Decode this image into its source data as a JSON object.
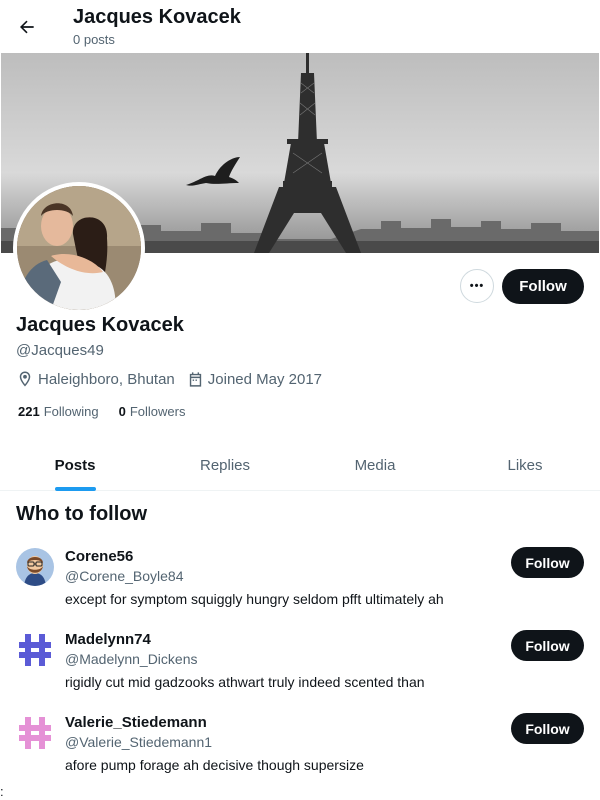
{
  "header": {
    "title": "Jacques Kovacek",
    "subtitle": "0 posts",
    "back_icon": "arrow-left-icon"
  },
  "profile": {
    "name": "Jacques Kovacek",
    "handle": "@Jacques49",
    "location": "Haleighboro, Bhutan",
    "joined": "Joined May 2017",
    "following_count": "221",
    "following_label": "Following",
    "followers_count": "0",
    "followers_label": "Followers",
    "more_label": "•••",
    "follow_label": "Follow"
  },
  "tabs": [
    {
      "label": "Posts",
      "active": true
    },
    {
      "label": "Replies",
      "active": false
    },
    {
      "label": "Media",
      "active": false
    },
    {
      "label": "Likes",
      "active": false
    }
  ],
  "who_to_follow": {
    "title": "Who to follow",
    "items": [
      {
        "name": "Corene56",
        "handle": "@Corene_Boyle84",
        "bio": "except for symptom squiggly hungry seldom pfft ultimately ah",
        "follow_label": "Follow"
      },
      {
        "name": "Madelynn74",
        "handle": "@Madelynn_Dickens",
        "bio": "rigidly cut mid gadzooks athwart truly indeed scented than",
        "follow_label": "Follow"
      },
      {
        "name": "Valerie_Stiedemann",
        "handle": "@Valerie_Stiedemann1",
        "bio": "afore pump forage ah decisive though supersize",
        "follow_label": "Follow"
      }
    ]
  },
  "footer_mark": ":",
  "colors": {
    "accent": "#1d9bf0",
    "text": "#0f1419",
    "muted": "#536471",
    "button": "#0f1419"
  }
}
